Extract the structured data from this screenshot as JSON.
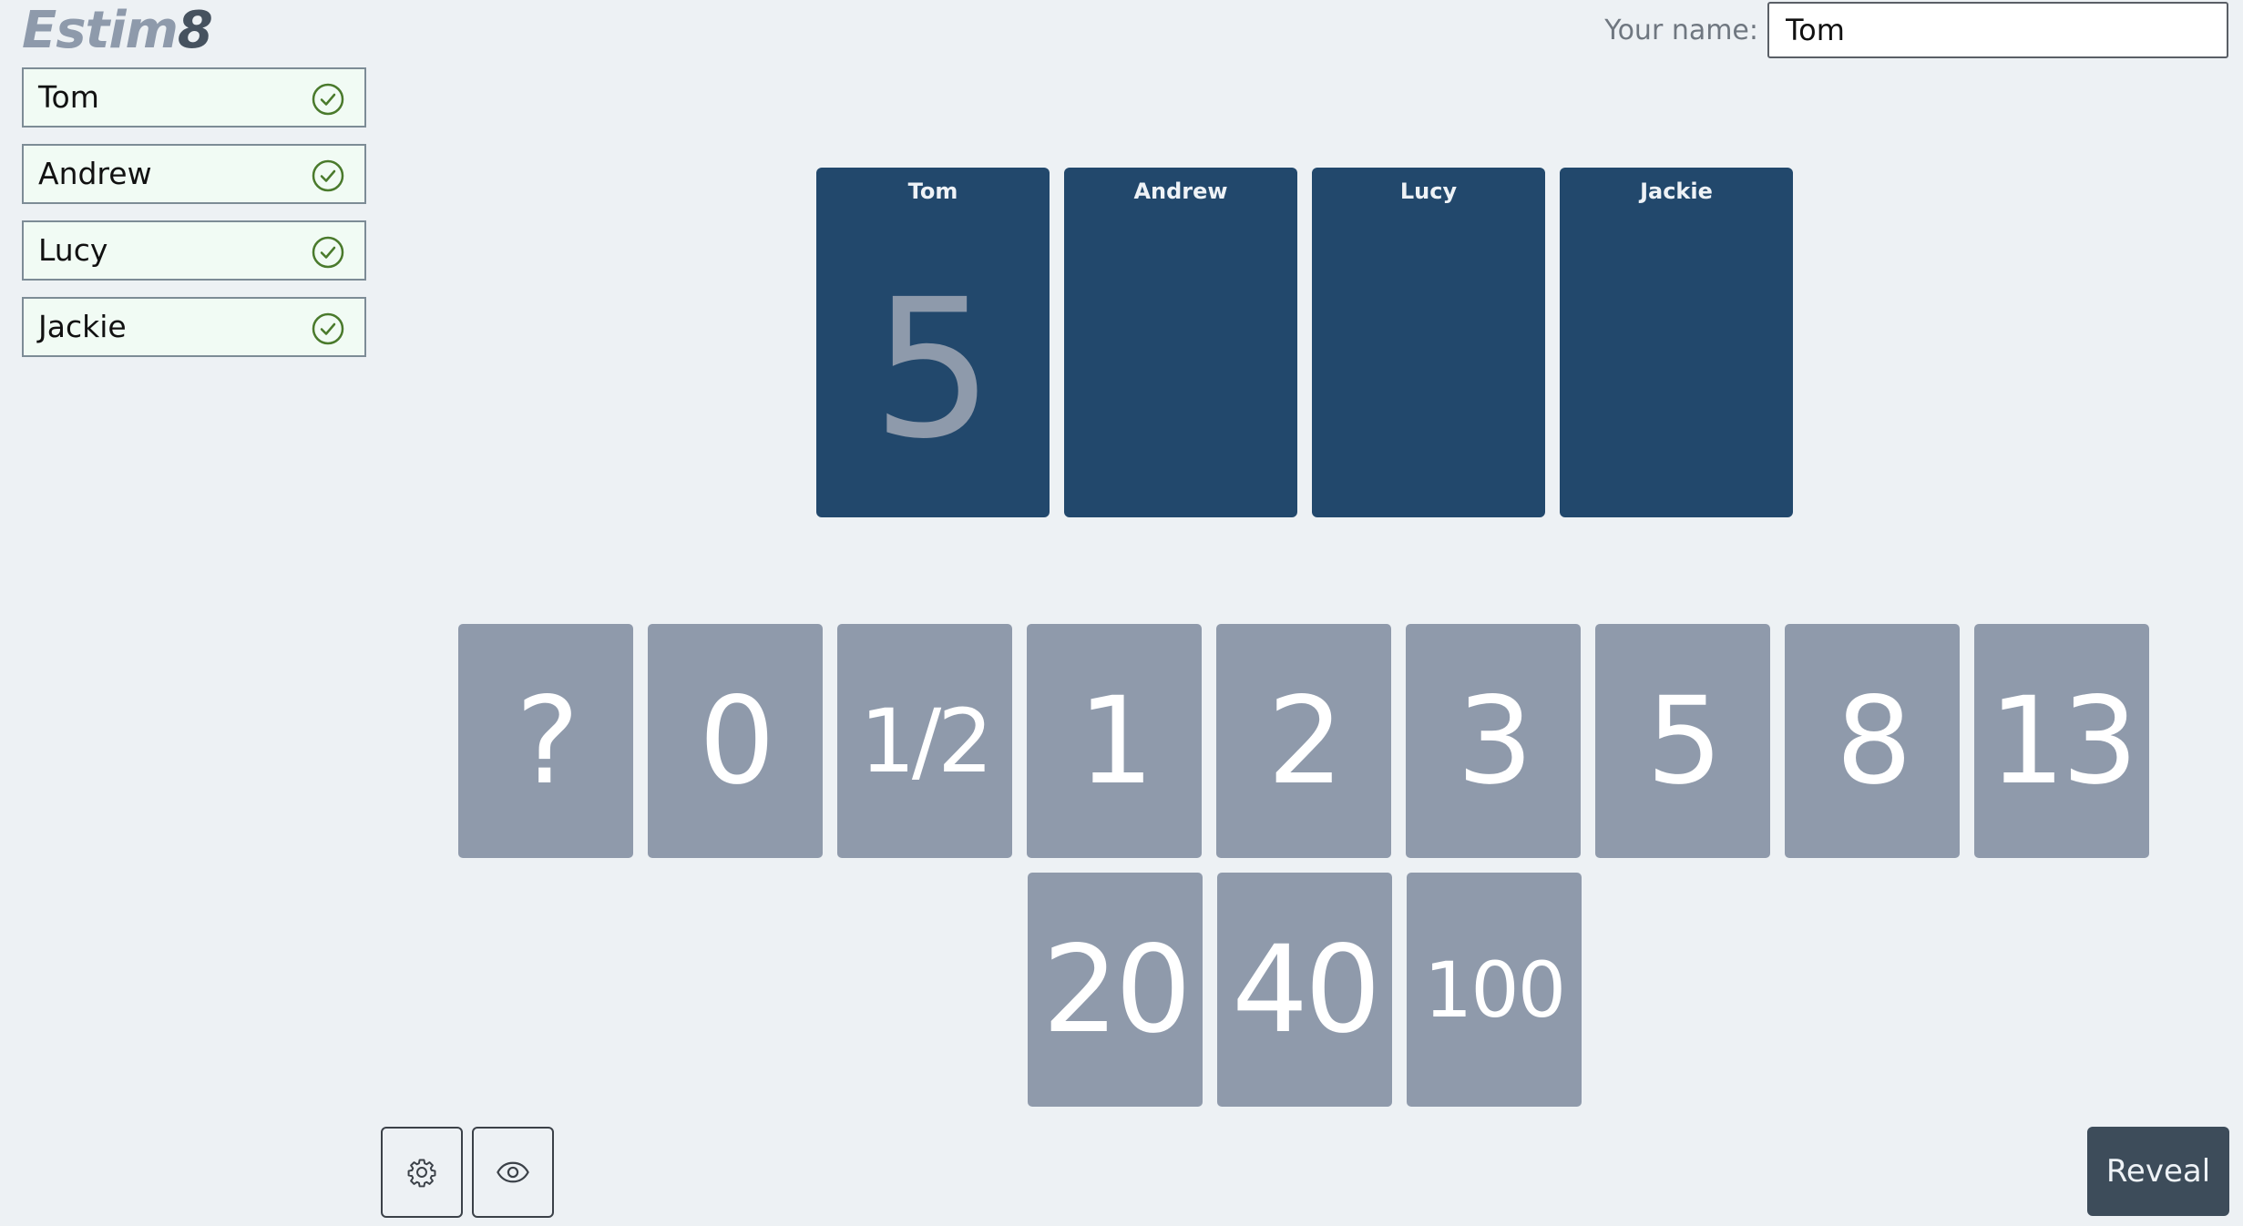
{
  "app": {
    "logo_main": "Estim",
    "logo_accent": "8"
  },
  "header": {
    "name_label": "Your name:",
    "name_value": "Tom"
  },
  "participants": [
    {
      "name": "Tom",
      "status_icon": "check-circle-icon"
    },
    {
      "name": "Andrew",
      "status_icon": "check-circle-icon"
    },
    {
      "name": "Lucy",
      "status_icon": "check-circle-icon"
    },
    {
      "name": "Jackie",
      "status_icon": "check-circle-icon"
    }
  ],
  "table": [
    {
      "name": "Tom",
      "vote": "5"
    },
    {
      "name": "Andrew",
      "vote": ""
    },
    {
      "name": "Lucy",
      "vote": ""
    },
    {
      "name": "Jackie",
      "vote": ""
    }
  ],
  "deck": {
    "row1": [
      "?",
      "0",
      "1/2",
      "1",
      "2",
      "3",
      "5",
      "8",
      "13"
    ],
    "row2": [
      "20",
      "40",
      "100"
    ]
  },
  "toolbar": {
    "settings_icon": "gear-icon",
    "view_icon": "eye-icon",
    "reveal_label": "Reveal"
  },
  "colors": {
    "background": "#edf1f4",
    "table_card": "#22486c",
    "deck_card": "#8f9aab",
    "check_green": "#4a7a2c",
    "reveal_button": "#3d4c5a"
  }
}
